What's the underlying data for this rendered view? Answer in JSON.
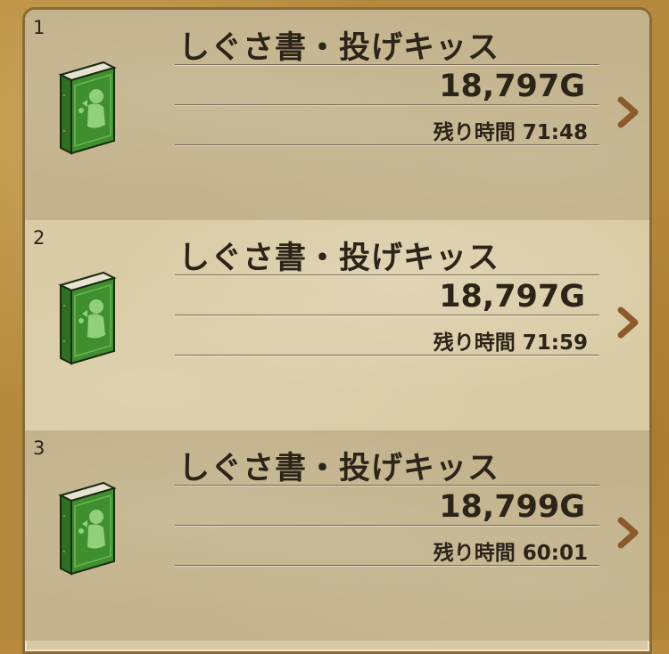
{
  "listings": [
    {
      "index": "1",
      "name": "しぐさ書・投げキッス",
      "price": "18,797G",
      "time_label": "残り時間 71:48"
    },
    {
      "index": "2",
      "name": "しぐさ書・投げキッス",
      "price": "18,797G",
      "time_label": "残り時間 71:59"
    },
    {
      "index": "3",
      "name": "しぐさ書・投げキッス",
      "price": "18,799G",
      "time_label": "残り時間 60:01"
    }
  ],
  "colors": {
    "frame": "#b5893d",
    "row_dark": "#c3b38d",
    "row_light": "#d9cba5",
    "text": "#2c2418",
    "book_green": "#3f8f2f",
    "chevron": "#8a5a2a"
  },
  "icons": {
    "item": "green-book-icon",
    "next": "chevron-right-icon"
  }
}
